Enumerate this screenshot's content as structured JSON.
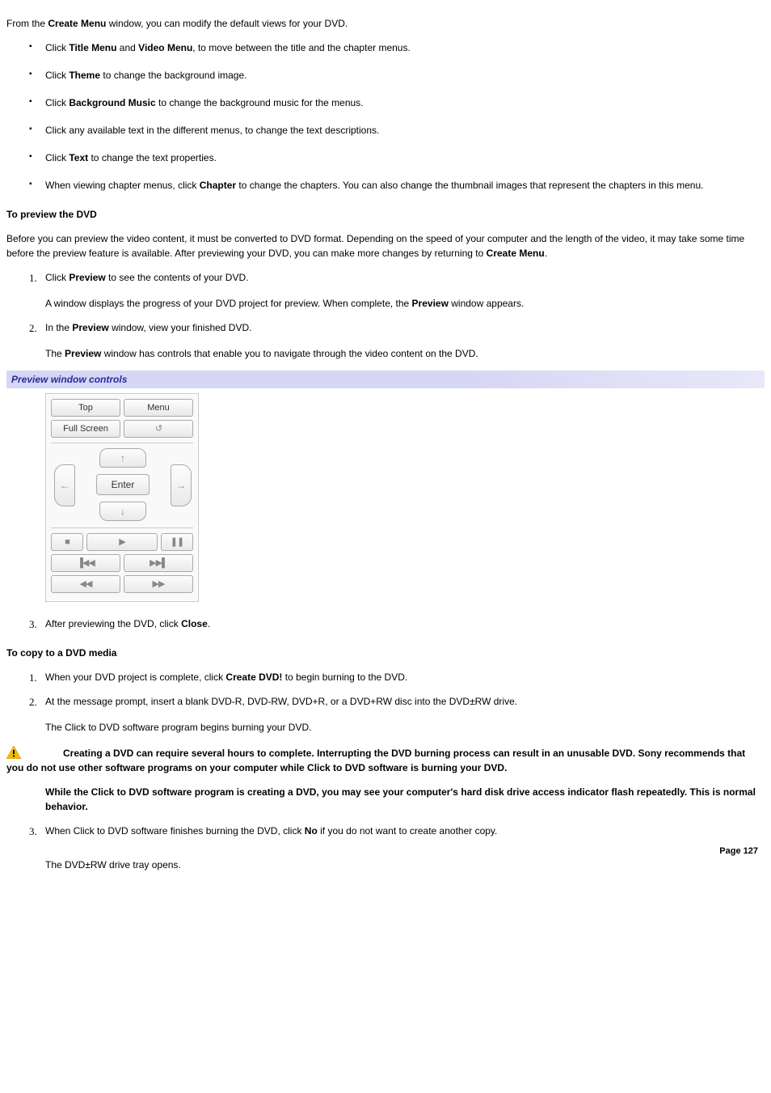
{
  "intro": {
    "pre": "From the ",
    "bold": "Create Menu",
    "post": " window, you can modify the default views for your DVD."
  },
  "bullets": {
    "b1": {
      "pre": "Click ",
      "bold1": "Title Menu",
      "mid": " and ",
      "bold2": "Video Menu",
      "post": ", to move between the title and the chapter menus."
    },
    "b2": {
      "pre": "Click ",
      "bold": "Theme",
      "post": " to change the background image."
    },
    "b3": {
      "pre": "Click ",
      "bold": "Background Music",
      "post": " to change the background music for the menus."
    },
    "b4": {
      "text": "Click any available text in the different menus, to change the text descriptions."
    },
    "b5": {
      "pre": "Click ",
      "bold": "Text",
      "post": " to change the text properties."
    },
    "b6": {
      "pre": "When viewing chapter menus, click ",
      "bold": "Chapter",
      "post": " to change the chapters. You can also change the thumbnail images that represent the chapters in this menu."
    }
  },
  "section_preview_head": "To preview the DVD",
  "preview_intro": {
    "pre": "Before you can preview the video content, it must be converted to DVD format. Depending on the speed of your computer and the length of the video, it may take some time before the preview feature is available. After previewing your DVD, you can make more changes by returning to ",
    "bold": "Create Menu",
    "post": "."
  },
  "preview_steps": {
    "s1": {
      "pre": "Click ",
      "bold": "Preview",
      "post": " to see the contents of your DVD.",
      "sub_pre": "A window displays the progress of your DVD project for preview. When complete, the ",
      "sub_bold": "Preview",
      "sub_post": " window appears."
    },
    "s2": {
      "pre": "In the ",
      "bold": "Preview",
      "post": " window, view your finished DVD.",
      "sub_pre": "The ",
      "sub_bold": "Preview",
      "sub_post": " window has controls that enable you to navigate through the video content on the DVD."
    },
    "s3": {
      "pre": "After previewing the DVD, click ",
      "bold": "Close",
      "post": "."
    }
  },
  "caption": "Preview window controls",
  "panel": {
    "top": "Top",
    "menu": "Menu",
    "fullscreen": "Full Screen",
    "enter": "Enter"
  },
  "section_copy_head": "To copy to a DVD media",
  "copy_steps": {
    "s1": {
      "pre": "When your DVD project is complete, click ",
      "bold": "Create DVD!",
      "post": " to begin burning to the DVD."
    },
    "s2": {
      "text": "At the message prompt, insert a blank DVD-R, DVD-RW, DVD+R, or a DVD+RW disc into the DVD±RW drive.",
      "sub": "The Click to DVD    software program begins burning your DVD."
    },
    "s3": {
      "pre": "When Click to DVD software finishes burning the DVD, click ",
      "bold": "No",
      "post": " if you do not want to create another copy.",
      "sub": "The DVD±RW drive tray opens."
    }
  },
  "warning": {
    "p1": "Creating a DVD can require several hours to complete. Interrupting the DVD burning process can result in an unusable DVD. Sony recommends that you do not use other software programs on your computer while Click to DVD software is burning your DVD.",
    "p2": "While the Click to DVD software program is creating a DVD, you may see your computer's hard disk drive access indicator flash repeatedly. This is normal behavior."
  },
  "page_number": "Page 127"
}
